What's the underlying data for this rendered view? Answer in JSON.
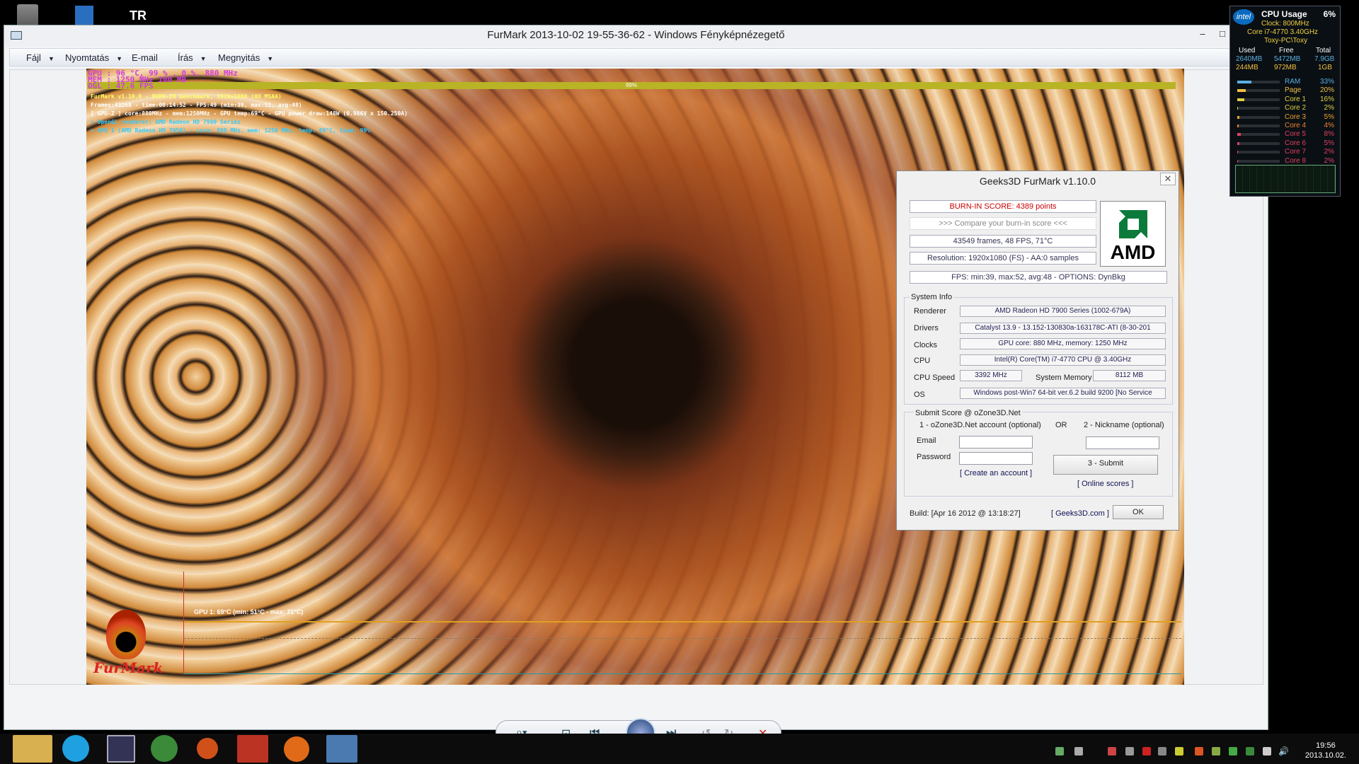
{
  "window": {
    "title": "FurMark 2013-10-02 19-55-36-62 - Windows Fényképnézegető",
    "minimize": "–",
    "maximize": "□"
  },
  "menu": {
    "items": [
      {
        "label": "Fájl"
      },
      {
        "label": "Nyomtatás"
      },
      {
        "label": "E-mail"
      },
      {
        "label": "Írás"
      },
      {
        "label": "Megnyitás"
      }
    ]
  },
  "hud": {
    "line1": "GPU : 96 °C, 99 % , 0.%, 880 MHz",
    "line2": "MEM : 1250 MHz  100 MB",
    "line3": "OGL : 47.6 FPS",
    "bar": "99%",
    "info1": "FurMark v1.10.0 - BURN-IN benchmark, 1920x1080 (0X MSAA)",
    "info2": "Frames:43268 - time:00:14:52 - FPS:49 (min:39, max:51, avg:48)",
    "info3": "[ GPU-Z ] core:880MHz - mem:1250MHz - GPU temp:69°C - GPU power draw:148W (0.986V x 150.250A)",
    "info4": "> OpenGL renderer: AMD Radeon HD 7900 Series",
    "info5": "> GPU 1 (AMD Radeon HD 7950) - core: 880 MHz, mem: 1250 MHz, temp: 69°C, load: 99%",
    "graph": "GPU 1: 69°C (min: 51°C - max: 71°C)",
    "logo": "FurMark"
  },
  "dialog": {
    "title": "Geeks3D FurMark v1.10.0",
    "close": "✕",
    "score": "BURN-IN SCORE: 4389 points",
    "compare": ">>> Compare your burn-in score <<<",
    "frames": "43549 frames, 48 FPS, 71°C",
    "resolution": "Resolution: 1920x1080 (FS) - AA:0 samples",
    "fps": "FPS: min:39, max:52, avg:48 - OPTIONS: DynBkg",
    "amd": "AMD",
    "sysinfo": "System Info",
    "labels": {
      "renderer": "Renderer",
      "drivers": "Drivers",
      "clocks": "Clocks",
      "cpu": "CPU",
      "cpuspeed": "CPU Speed",
      "sysmem": "System Memory",
      "os": "OS"
    },
    "values": {
      "renderer": "AMD Radeon HD 7900 Series (1002-679A)",
      "drivers": "Catalyst 13.9 - 13.152-130830a-163178C-ATI (8-30-201",
      "clocks": "GPU core: 880 MHz, memory: 1250 MHz",
      "cpu": "Intel(R) Core(TM) i7-4770 CPU @ 3.40GHz",
      "cpuspeed": "3392 MHz",
      "sysmem": "8112 MB",
      "os": "Windows post-Win7 64-bit ver.6.2 build 9200 [No Service"
    },
    "submit": {
      "title": "Submit Score @ oZone3D.Net",
      "opt1": "1 - oZone3D.Net account (optional)",
      "or": "OR",
      "opt2": "2 - Nickname (optional)",
      "email": "Email",
      "password": "Password",
      "create": "[ Create an account ]",
      "submit": "3 - Submit",
      "online": "[ Online scores ]"
    },
    "build": "Build: [Apr 16 2012 @ 13:18:27]",
    "geeks": "[ Geeks3D.com ]",
    "ok": "OK"
  },
  "cpu": {
    "title": "CPU Usage",
    "pct": "6%",
    "clock": "Clock: 800MHz",
    "model": "Core i7-4770 3.40GHz",
    "host": "Toxy-PC\\Toxy",
    "cols": [
      "Used",
      "Free",
      "Total"
    ],
    "rows": [
      [
        "2640MB",
        "5472MB",
        "7.9GB"
      ],
      [
        "244MB",
        "972MB",
        "1GB"
      ]
    ],
    "items": [
      {
        "name": "RAM",
        "pct": "33%",
        "v": 0.33,
        "color": "#5ab0e0"
      },
      {
        "name": "Page",
        "pct": "20%",
        "v": 0.2,
        "color": "#f0c040"
      },
      {
        "name": "Core 1",
        "pct": "16%",
        "v": 0.16,
        "color": "#e0d040"
      },
      {
        "name": "Core 2",
        "pct": "2%",
        "v": 0.02,
        "color": "#e0d040"
      },
      {
        "name": "Core 3",
        "pct": "5%",
        "v": 0.05,
        "color": "#f0a030"
      },
      {
        "name": "Core 4",
        "pct": "4%",
        "v": 0.04,
        "color": "#f08030"
      },
      {
        "name": "Core 5",
        "pct": "8%",
        "v": 0.08,
        "color": "#e04060"
      },
      {
        "name": "Core 6",
        "pct": "5%",
        "v": 0.05,
        "color": "#e04060"
      },
      {
        "name": "Core 7",
        "pct": "2%",
        "v": 0.02,
        "color": "#e04060"
      },
      {
        "name": "Core 8",
        "pct": "2%",
        "v": 0.02,
        "color": "#e04060"
      }
    ]
  },
  "taskbar": {
    "clock": "19:56",
    "date": "2013.10.02."
  }
}
